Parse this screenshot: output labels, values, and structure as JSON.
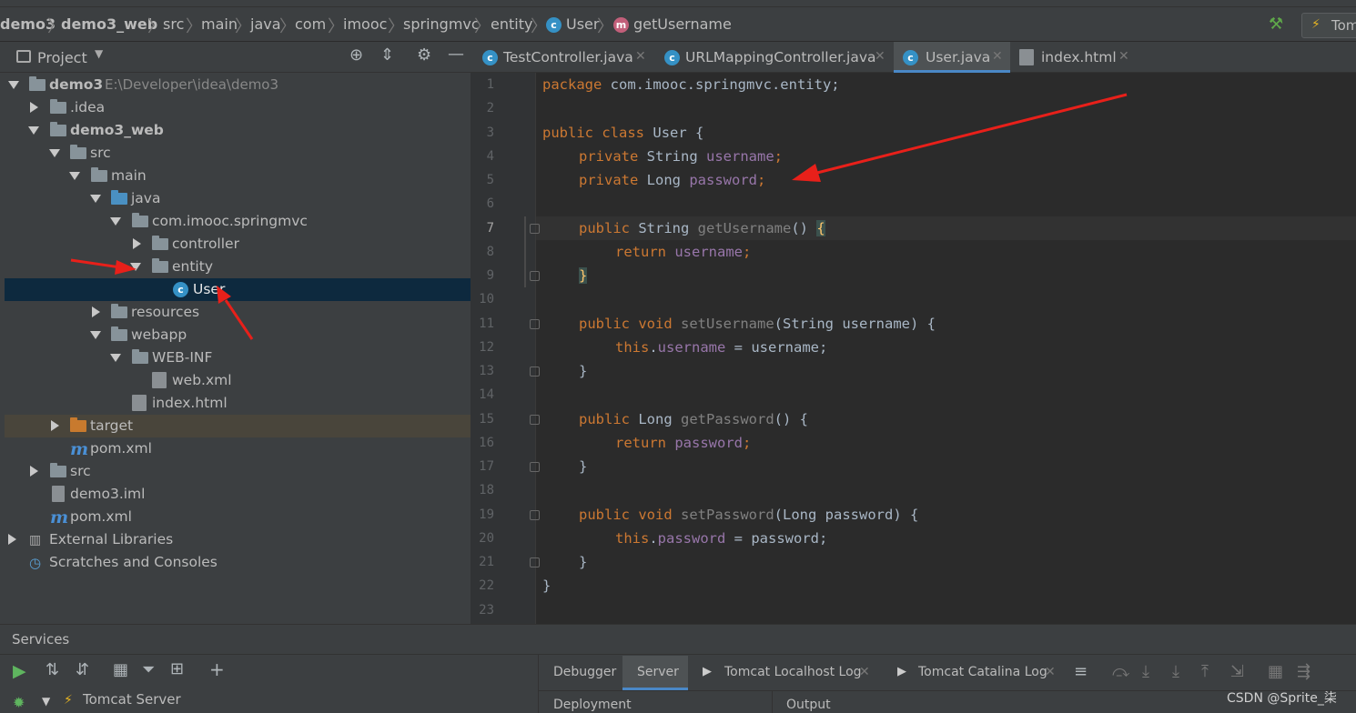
{
  "breadcrumb": [
    "demo3",
    "demo3_web",
    "src",
    "main",
    "java",
    "com",
    "imooc",
    "springmvc",
    "entity",
    "User",
    "getUsername"
  ],
  "run_config": "Tom",
  "project_panel": {
    "title": "Project",
    "tree": [
      {
        "label": "demo3",
        "path": "E:\\Developer\\idea\\demo3"
      },
      {
        "label": ".idea"
      },
      {
        "label": "demo3_web"
      },
      {
        "label": "src"
      },
      {
        "label": "main"
      },
      {
        "label": "java"
      },
      {
        "label": "com.imooc.springmvc"
      },
      {
        "label": "controller"
      },
      {
        "label": "entity"
      },
      {
        "label": "User"
      },
      {
        "label": "resources"
      },
      {
        "label": "webapp"
      },
      {
        "label": "WEB-INF"
      },
      {
        "label": "web.xml"
      },
      {
        "label": "index.html"
      },
      {
        "label": "target"
      },
      {
        "label": "pom.xml"
      },
      {
        "label": "src"
      },
      {
        "label": "demo3.iml"
      },
      {
        "label": "pom.xml"
      },
      {
        "label": "External Libraries"
      },
      {
        "label": "Scratches and Consoles"
      }
    ]
  },
  "tabs": [
    "TestController.java",
    "URLMappingController.java",
    "User.java",
    "index.html"
  ],
  "active_tab": "User.java",
  "line_numbers": [
    "1",
    "2",
    "3",
    "4",
    "5",
    "6",
    "7",
    "8",
    "9",
    "10",
    "11",
    "12",
    "13",
    "14",
    "15",
    "16",
    "17",
    "18",
    "19",
    "20",
    "21",
    "22",
    "23"
  ],
  "code": {
    "l1": "com.imooc.springmvc.entity;",
    "l3": "User {",
    "l4_type": "String ",
    "l4_field": "username",
    "l5_type": "Long ",
    "l5_field": "password",
    "l7_type": "String ",
    "l7_method": "getUsername",
    "l8_field": "username",
    "l11_method": "setUsername",
    "l11_params": "(String username) {",
    "l12_field": "username",
    "l12_rest": " = username;",
    "l15_type": "Long ",
    "l15_method": "getPassword",
    "l16_field": "password",
    "l19_method": "setPassword",
    "l19_params": "(Long password) {",
    "l20_field": "password",
    "l20_rest": " = password;"
  },
  "keywords": {
    "package": "package",
    "public": "public",
    "class": "class",
    "private": "private",
    "return": "return",
    "void": "void",
    "this": "this"
  },
  "services": {
    "title": "Services",
    "tabs": [
      "Debugger",
      "Server",
      "Tomcat Localhost Log",
      "Tomcat Catalina Log"
    ],
    "tree_item": "Tomcat Server",
    "columns": [
      "Deployment",
      "Output"
    ]
  },
  "watermark": "CSDN @Sprite_柒",
  "colors": {
    "keyword": "#cc7832",
    "field": "#9876aa",
    "method": "#ffc66d",
    "text": "#a9b7c6",
    "selection": "#0d293e",
    "arrow": "#e8201a"
  }
}
